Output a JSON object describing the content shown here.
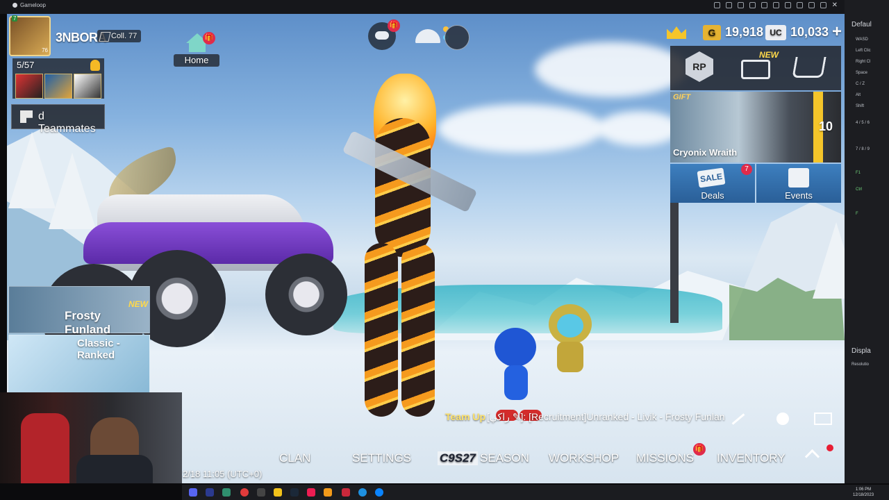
{
  "window": {
    "app_title": "Gameloop"
  },
  "player": {
    "name": "3NBORA",
    "avatar_tag": "7",
    "avatar_level": "76",
    "collection": "Coll. 77"
  },
  "home": {
    "label": "Home"
  },
  "friends": {
    "count": "5/57"
  },
  "teammates": {
    "label": "d Teammates"
  },
  "modes": [
    {
      "name": "Frosty Funland",
      "tag": "NEW"
    },
    {
      "name": "Classic - Ranked"
    }
  ],
  "currency": {
    "g_icon": "G",
    "g_value": "19,918",
    "uc_icon": "UC",
    "uc_value": "10,033",
    "add": "+"
  },
  "shop": {
    "rp_label": "RP",
    "crate_tag": "NEW"
  },
  "featured": {
    "brand": "GIFT",
    "name": "Cryonix Wraith",
    "count": "10"
  },
  "deals": {
    "sale_icon": "SALE",
    "label": "Deals",
    "badge": "7"
  },
  "events": {
    "label": "Events"
  },
  "chat": {
    "team_label": "Team Up",
    "message": "[راكي ✎]: [Recruitment]Unranked - Livik - Frosty Funlan"
  },
  "bottom_nav": {
    "clan": "CLAN",
    "settings": "SETTINGS",
    "season_tag": "C9S27",
    "season": "SEASON",
    "workshop": "WORKSHOP",
    "missions": "MISSIONS",
    "inventory": "INVENTORY"
  },
  "timestamp": "2/18 11:05 (UTC+0)",
  "sidebar": {
    "header": "Defaul",
    "keys": [
      "WASD",
      "Left Clic",
      "Right Cl",
      "Space",
      "C / Z",
      "Alt",
      "Shift",
      "4 / 5 / 6",
      "7 / 8 / 9",
      "F1",
      "Ctrl",
      "F"
    ],
    "display": "Displa",
    "resolution": "Resolutio"
  },
  "system_clock": {
    "time": "1:06 PM",
    "date": "12/18/2023"
  },
  "colors": {
    "accent_gold": "#f5c52a",
    "badge_red": "#e02b4a",
    "team_yellow": "#ffe36a",
    "panel_blue": "#3d7fbf"
  }
}
